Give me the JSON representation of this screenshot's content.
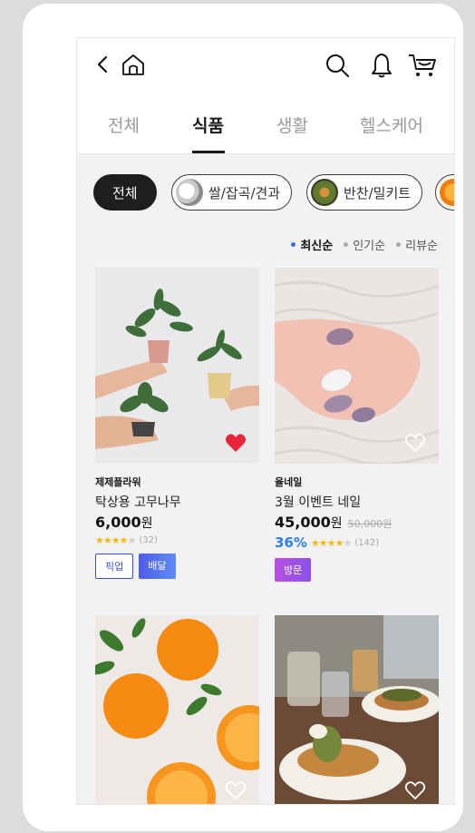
{
  "header": {
    "back_icon": "chevron-left-icon",
    "home_icon": "home-icon",
    "search_icon": "search-icon",
    "bell_icon": "bell-icon",
    "cart_icon": "cart-icon"
  },
  "tabs": [
    {
      "label": "전체"
    },
    {
      "label": "식품"
    },
    {
      "label": "생활"
    },
    {
      "label": "헬스케어"
    }
  ],
  "active_tab": "식품",
  "chips": [
    {
      "label": "전체"
    },
    {
      "label": "쌀/잡곡/견과"
    },
    {
      "label": "반찬/밀키트"
    }
  ],
  "sort": [
    {
      "label": "최신순"
    },
    {
      "label": "인기순"
    },
    {
      "label": "리뷰순"
    }
  ],
  "products": [
    {
      "brand": "제제플라워",
      "name": "탁상용 고무나무",
      "price": "6,000",
      "currency": "원",
      "review_count": "(32)",
      "rating": 4,
      "liked": true,
      "badges": {
        "pickup": "픽업",
        "delivery": "배달"
      }
    },
    {
      "brand": "율네일",
      "name": "3월 이벤트 네일",
      "price": "45,000",
      "currency": "원",
      "original_price": "50,000원",
      "discount": "36%",
      "review_count": "(142)",
      "rating": 4,
      "liked": false,
      "badges": {
        "visit": "방문"
      }
    }
  ],
  "colors": {
    "accent_blue": "#2d7ff2",
    "like_red": "#e8253a",
    "star": "#f5b90f"
  }
}
